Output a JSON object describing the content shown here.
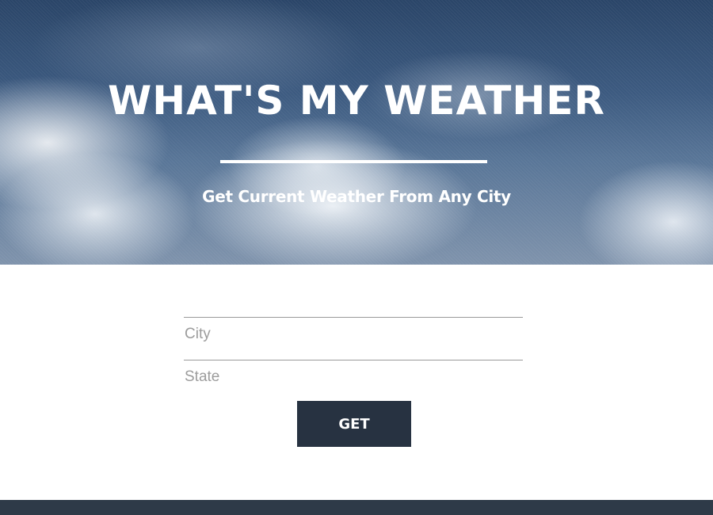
{
  "hero": {
    "title": "WHAT'S MY WEATHER",
    "subtitle": "Get Current Weather From Any City"
  },
  "form": {
    "city": {
      "value": "",
      "placeholder": "City"
    },
    "state": {
      "value": "",
      "placeholder": "State"
    },
    "submit_label": "GET"
  },
  "colors": {
    "button_bg": "#273241",
    "footer_bg": "#2e3a48",
    "hero_sky": "#3c5a80"
  }
}
